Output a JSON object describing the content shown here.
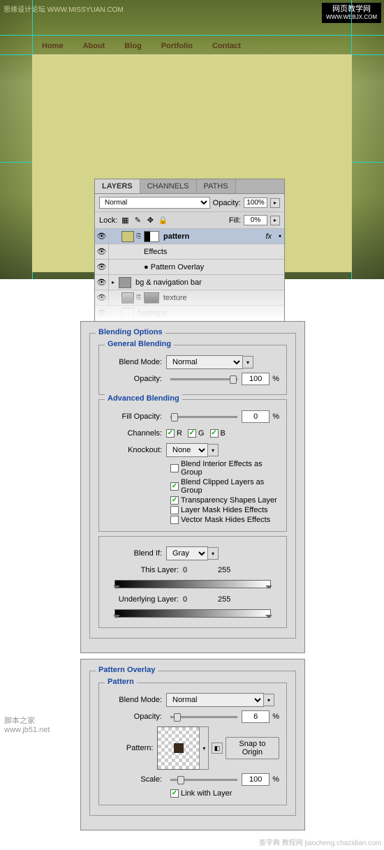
{
  "mockup": {
    "wm_tl": "思缘设计论坛  WWW.MISSYUAN.COM",
    "wm_tr_title": "网页教学网",
    "wm_tr_url": "WWW.WEBJX.COM",
    "nav": [
      "Home",
      "About",
      "Blog",
      "Portfolio",
      "Contact"
    ]
  },
  "layers_panel": {
    "tabs": [
      "LAYERS",
      "CHANNELS",
      "PATHS"
    ],
    "blend_mode": "Normal",
    "opacity_label": "Opacity:",
    "opacity_value": "100%",
    "lock_label": "Lock:",
    "fill_label": "Fill:",
    "fill_value": "0%",
    "layers": [
      {
        "name": "pattern",
        "fx": "fx",
        "selected": true
      },
      {
        "name": "Effects",
        "sub": true
      },
      {
        "name": "Pattern Overlay",
        "sub": true,
        "bullet": true
      },
      {
        "name": "bg & navigation bar",
        "folder": true
      },
      {
        "name": "texture",
        "gray": true
      },
      {
        "name": "highlight",
        "faded": true
      }
    ]
  },
  "blending": {
    "title": "Blending Options",
    "general": {
      "title": "General Blending",
      "blend_mode_label": "Blend Mode:",
      "blend_mode": "Normal",
      "opacity_label": "Opacity:",
      "opacity": "100",
      "pct": "%"
    },
    "advanced": {
      "title": "Advanced Blending",
      "fill_label": "Fill Opacity:",
      "fill": "0",
      "channels_label": "Channels:",
      "ch_r": "R",
      "ch_g": "G",
      "ch_b": "B",
      "knockout_label": "Knockout:",
      "knockout": "None",
      "opts": [
        {
          "label": "Blend Interior Effects as Group",
          "on": false
        },
        {
          "label": "Blend Clipped Layers as Group",
          "on": true
        },
        {
          "label": "Transparency Shapes Layer",
          "on": true
        },
        {
          "label": "Layer Mask Hides Effects",
          "on": false
        },
        {
          "label": "Vector Mask Hides Effects",
          "on": false
        }
      ]
    },
    "blendif": {
      "label": "Blend If:",
      "value": "Gray",
      "this_label": "This Layer:",
      "this_lo": "0",
      "this_hi": "255",
      "under_label": "Underlying Layer:",
      "under_lo": "0",
      "under_hi": "255"
    }
  },
  "pattern": {
    "title": "Pattern Overlay",
    "section": "Pattern",
    "blend_mode_label": "Blend Mode:",
    "blend_mode": "Normal",
    "opacity_label": "Opacity:",
    "opacity": "6",
    "pattern_label": "Pattern:",
    "snap": "Snap to Origin",
    "scale_label": "Scale:",
    "scale": "100",
    "link": "Link with Layer",
    "pct": "%"
  },
  "watermarks": {
    "bl_title": "脚本之家",
    "bl_url": "www.jb51.net",
    "br": "查字典 教程网  jiaocheng.chazidian.com"
  }
}
